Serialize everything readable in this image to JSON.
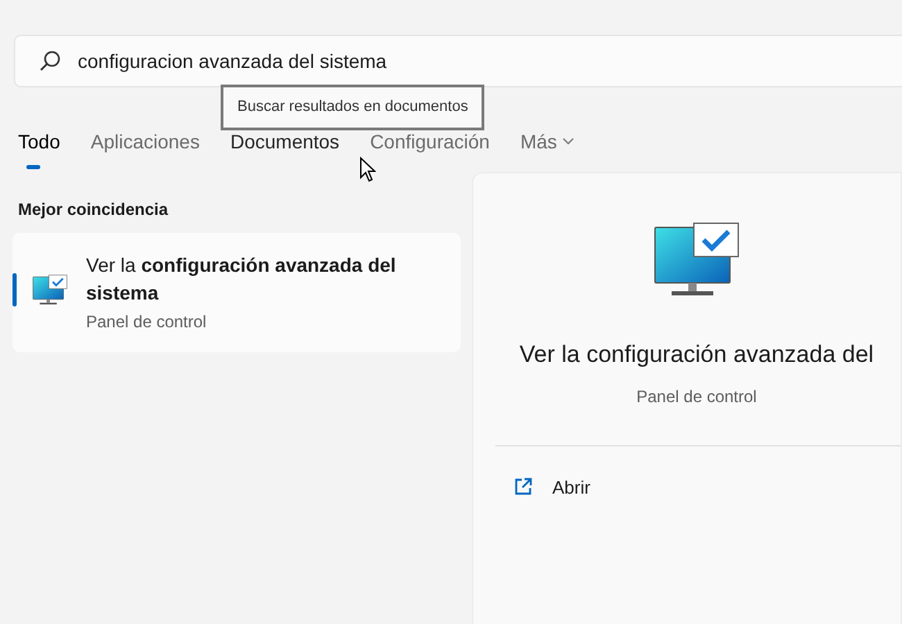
{
  "search": {
    "value": "configuracion avanzada del sistema"
  },
  "tooltip": "Buscar resultados en documentos",
  "tabs": [
    {
      "label": "Todo",
      "selected": true,
      "hovered": false
    },
    {
      "label": "Aplicaciones",
      "selected": false,
      "hovered": false
    },
    {
      "label": "Documentos",
      "selected": false,
      "hovered": true
    },
    {
      "label": "Configuración",
      "selected": false,
      "hovered": false
    },
    {
      "label": "Más",
      "selected": false,
      "hovered": false,
      "kind": "dropdown"
    }
  ],
  "best_match": {
    "heading": "Mejor coincidencia",
    "title": "Ver la **configuración avanzada del sistema**",
    "subtitle": "Panel de control",
    "selected": true
  },
  "detail": {
    "title": "Ver la configuración avanzada del",
    "subtitle": "Panel de control",
    "actions": [
      {
        "label": "Abrir"
      }
    ]
  }
}
